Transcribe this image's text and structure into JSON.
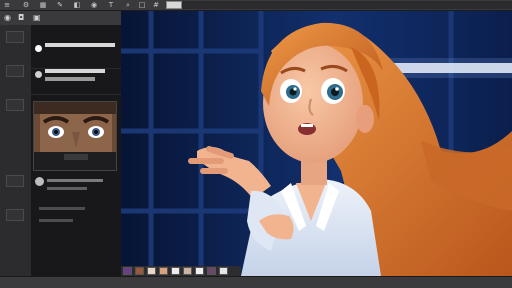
{
  "toolbar": {
    "icons": [
      "menu-icon",
      "gear-icon",
      "layers-icon",
      "brush-icon",
      "bucket-icon",
      "eye-icon",
      "text-icon",
      "zoom-icon",
      "shape-icon",
      "grid-icon",
      "hand-icon"
    ],
    "field_value": ""
  },
  "left_panel": {
    "header_icons": [
      "eye-icon",
      "lock-icon",
      "camera-icon"
    ],
    "rows": [
      {
        "label": "",
        "sublabel": ""
      },
      {
        "label": "",
        "sublabel": ""
      }
    ]
  },
  "viewport": {
    "scene": "animated-woman-portrait"
  },
  "colors": {
    "toolbar": "#3a3a3c",
    "panel": "#1f1f21",
    "viewport_bg": "#0e1f47",
    "hair": "#d9782f",
    "skin": "#f2b48f",
    "shirt": "#dfe7f4"
  }
}
